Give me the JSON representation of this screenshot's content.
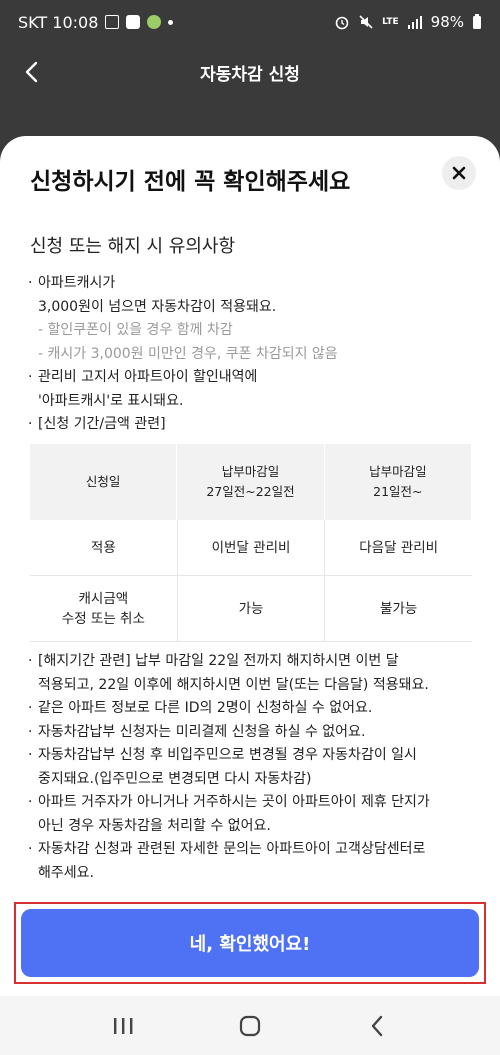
{
  "status_bar": {
    "time": "SKT 10:08",
    "battery": "98%",
    "lte": "LTE"
  },
  "header": {
    "title": "자동차감 신청"
  },
  "sheet": {
    "title": "신청하시기 전에 꼭 확인해주세요",
    "section_title": "신청 또는 해지 시 유의사항",
    "notes": {
      "n1_line1": "아파트캐시가",
      "n1_line2": "3,000원이 넘으면 자동차감이 적용돼요.",
      "n1_sub1": "- 할인쿠폰이 있을 경우 함께 차감",
      "n1_sub2": "- 캐시가 3,000원 미만인 경우, 쿠폰 차감되지 않음",
      "n2_line1": "관리비 고지서 아파트아이 할인내역에",
      "n2_line2": "'아파트캐시'로 표시돼요.",
      "n3": "[신청 기간/금액 관련]"
    },
    "table": {
      "headers": [
        "신청일",
        "납부마감일\n27일전~22일전",
        "납부마감일\n21일전~"
      ],
      "header_col1": "신청일",
      "header_col2_l1": "납부마감일",
      "header_col2_l2": "27일전~22일전",
      "header_col3_l1": "납부마감일",
      "header_col3_l2": "21일전~",
      "row1": {
        "label": "적용",
        "c2": "이번달 관리비",
        "c3": "다음달 관리비"
      },
      "row2": {
        "label_l1": "캐시금액",
        "label_l2": "수정 또는 취소",
        "c2": "가능",
        "c3": "불가능"
      }
    },
    "notes2": {
      "a1": "[해지기간 관련] 납부 마감일 22일 전까지 해지하시면 이번 달",
      "a2": "적용되고, 22일 이후에 해지하시면 이번 달(또는 다음달) 적용돼요.",
      "b1": "같은 아파트 정보로 다른 ID의 2명이 신청하실 수 없어요.",
      "c1": "자동차감납부 신청자는 미리결제 신청을 하실 수 없어요.",
      "d1": "자동차감납부 신청 후 비입주민으로 변경될 경우 자동차감이 일시",
      "d2": "중지돼요.(입주민으로 변경되면 다시 자동차감)",
      "e1": "아파트 거주자가 아니거나 거주하시는 곳이 아파트아이 제휴 단지가",
      "e2": "아닌 경우 자동차감을 처리할 수 없어요.",
      "f1": "자동차감 신청과 관련된 자세한 문의는 아파트아이 고객상담센터로",
      "f2": "해주세요."
    },
    "confirm_label": "네, 확인했어요!"
  },
  "bullet": "·",
  "colors": {
    "primary": "#4f72f5",
    "highlight": "#d63031",
    "dark_bg": "#3a3a3a"
  },
  "icons": [
    "back-arrow-icon",
    "close-icon",
    "recent-apps-icon",
    "home-icon",
    "back-icon"
  ]
}
